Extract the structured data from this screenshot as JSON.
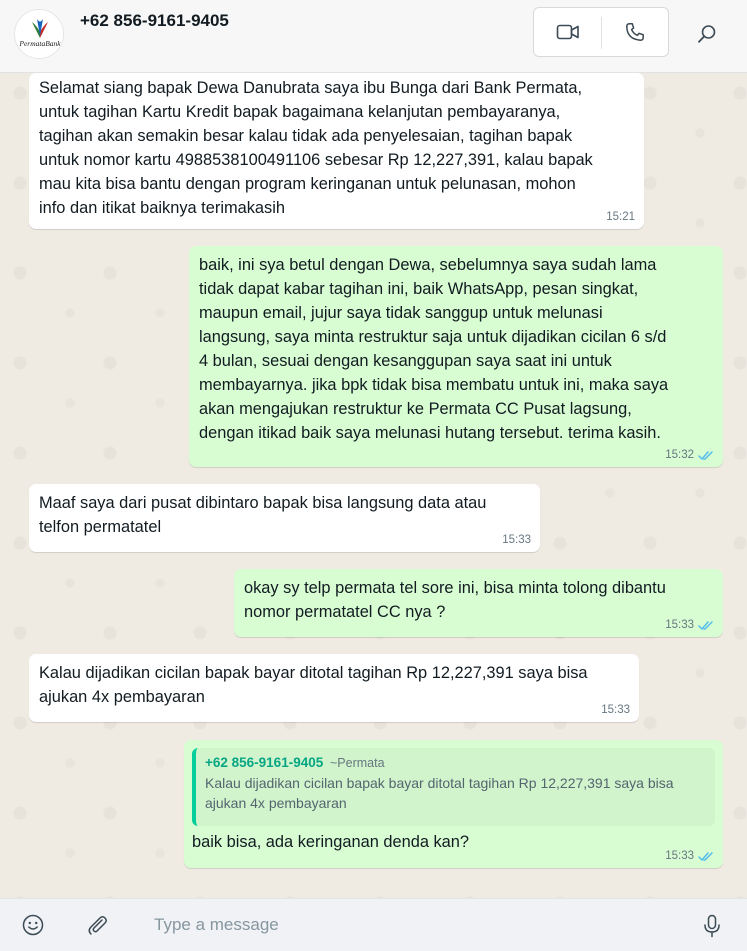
{
  "header": {
    "contact_name": "+62 856-9161-9405",
    "avatar_logo_text": "PermataBank",
    "icons": {
      "video": "video-camera-icon",
      "voice": "phone-icon",
      "search": "search-icon"
    }
  },
  "colors": {
    "incoming_bubble": "#ffffff",
    "outgoing_bubble": "#d9fdd3",
    "read_ticks": "#53bdeb",
    "quote_author": "#06a684",
    "chat_background": "#efeae2"
  },
  "messages": [
    {
      "direction": "incoming",
      "text": "Selamat siang bapak Dewa Danubrata saya ibu Bunga dari Bank Permata,\nuntuk tagihan Kartu Kredit bapak bagaimana kelanjutan pembayaranya,\ntagihan akan semakin besar kalau tidak ada penyelesaian, tagihan bapak\nuntuk nomor kartu 4988538100491106 sebesar Rp 12,227,391, kalau bapak\nmau kita bisa bantu dengan program keringanan untuk pelunasan, mohon\ninfo dan itikat baiknya terimakasih",
      "time": "15:21"
    },
    {
      "direction": "outgoing",
      "text": "baik, ini sya betul dengan Dewa, sebelumnya saya sudah lama\ntidak dapat kabar tagihan ini, baik WhatsApp, pesan singkat,\nmaupun email, jujur saya tidak sanggup untuk melunasi\nlangsung, saya minta restruktur saja untuk dijadikan cicilan 6 s/d\n4 bulan, sesuai dengan kesanggupan saya saat ini untuk\nmembayarnya. jika bpk tidak bisa membatu untuk ini, maka saya\nakan mengajukan restruktur ke Permata CC Pusat lagsung,\ndengan itikad baik saya melunasi hutang tersebut. terima kasih.",
      "time": "15:32",
      "status": "read"
    },
    {
      "direction": "incoming",
      "text": "Maaf saya dari pusat dibintaro bapak bisa langsung data atau\ntelfon permatatel",
      "time": "15:33"
    },
    {
      "direction": "outgoing",
      "text": "okay sy telp permata tel sore ini, bisa minta tolong dibantu\nnomor permatatel CC nya ?",
      "time": "15:33",
      "status": "read"
    },
    {
      "direction": "incoming",
      "text": "Kalau dijadikan cicilan bapak bayar ditotal tagihan Rp 12,227,391 saya bisa\najukan 4x pembayaran",
      "time": "15:33"
    },
    {
      "direction": "outgoing",
      "quote": {
        "author": "+62 856-9161-9405",
        "pushname": "~Permata",
        "text": "Kalau dijadikan cicilan bapak bayar ditotal tagihan Rp 12,227,391 saya bisa\najukan 4x pembayaran"
      },
      "text": "baik bisa, ada keringanan denda kan?",
      "time": "15:33",
      "status": "read"
    }
  ],
  "composer": {
    "placeholder": "Type a message",
    "icons": {
      "emoji": "emoji-icon",
      "attach": "paperclip-icon",
      "mic": "microphone-icon"
    }
  }
}
